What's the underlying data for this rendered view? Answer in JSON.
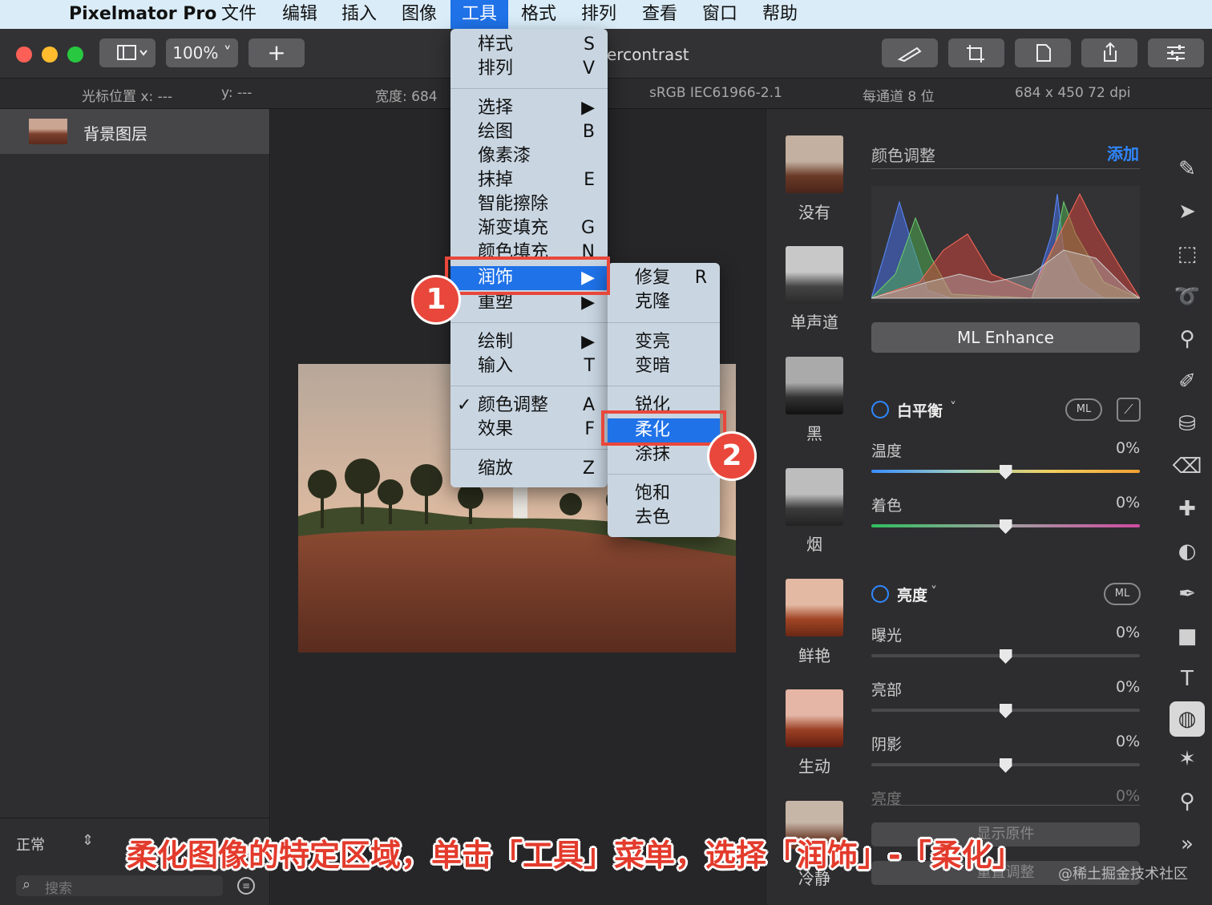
{
  "menubar": {
    "app_name": "Pixelmator Pro",
    "items": [
      "文件",
      "编辑",
      "插入",
      "图像",
      "工具",
      "格式",
      "排列",
      "查看",
      "窗口",
      "帮助"
    ],
    "active_item": "工具"
  },
  "toolbar": {
    "zoom": "100%",
    "add_label": "+",
    "document_title_partial": "ercontrast"
  },
  "infobar": {
    "cursor_label": "光标位置 x: ---",
    "cursor_y": "y: ---",
    "width": "宽度: 684",
    "color_profile": "sRGB IEC61966-2.1",
    "bit_depth": "每通道 8 位",
    "dimensions": "684 x 450 72 dpi"
  },
  "layers": {
    "items": [
      {
        "label": "背景图层"
      }
    ],
    "blend_mode": "正常",
    "search_placeholder": "搜索"
  },
  "tools_menu": {
    "rows": [
      {
        "label": "样式",
        "shortcut": "S"
      },
      {
        "label": "排列",
        "shortcut": "V"
      },
      {
        "label": "选择",
        "shortcut": "▶"
      },
      {
        "label": "绘图",
        "shortcut": "B"
      },
      {
        "label": "像素漆",
        "shortcut": ""
      },
      {
        "label": "抹掉",
        "shortcut": "E"
      },
      {
        "label": "智能擦除",
        "shortcut": ""
      },
      {
        "label": "渐变填充",
        "shortcut": "G"
      },
      {
        "label": "颜色填充",
        "shortcut": "N"
      },
      {
        "label": "润饰",
        "shortcut": "▶"
      },
      {
        "label": "重塑",
        "shortcut": "▶"
      },
      {
        "label": "绘制",
        "shortcut": "▶"
      },
      {
        "label": "输入",
        "shortcut": "T"
      },
      {
        "label": "颜色调整",
        "shortcut": "A",
        "checked": true
      },
      {
        "label": "效果",
        "shortcut": "F"
      },
      {
        "label": "缩放",
        "shortcut": "Z"
      }
    ],
    "check_mark": "✓"
  },
  "retouch_submenu": {
    "rows": [
      {
        "label": "修复",
        "shortcut": "R"
      },
      {
        "label": "克隆",
        "shortcut": ""
      },
      {
        "label": "变亮",
        "shortcut": ""
      },
      {
        "label": "变暗",
        "shortcut": ""
      },
      {
        "label": "锐化",
        "shortcut": ""
      },
      {
        "label": "柔化",
        "shortcut": ""
      },
      {
        "label": "涂抹",
        "shortcut": ""
      },
      {
        "label": "饱和",
        "shortcut": ""
      },
      {
        "label": "去色",
        "shortcut": ""
      }
    ]
  },
  "badges": [
    "1",
    "2"
  ],
  "presets": [
    "没有",
    "单声道",
    "黑",
    "烟",
    "鲜艳",
    "生动",
    "冷静"
  ],
  "adjust": {
    "header": "颜色调整",
    "add_label": "添加",
    "ml_enhance": "ML Enhance",
    "white_balance": {
      "title": "白平衡",
      "ml": "ML",
      "temperature_label": "温度",
      "temperature_value": "0%",
      "tint_label": "着色",
      "tint_value": "0%"
    },
    "lightness": {
      "title": "亮度",
      "ml": "ML",
      "exposure_label": "曝光",
      "exposure_value": "0%",
      "highlights_label": "亮部",
      "highlights_value": "0%",
      "shadows_label": "阴影",
      "shadows_value": "0%",
      "brightness_label": "亮度",
      "brightness_value": "0%"
    },
    "show_original": "显示原件",
    "reset": "重置调整"
  },
  "sliders": {
    "temperature_level": 0.5,
    "tint_level": 0.5,
    "exposure_level": 0.5,
    "highlights_level": 0.5,
    "shadows_level": 0.5
  },
  "colors": {
    "accent": "#1f72e8",
    "annotation_red": "#e9473b"
  },
  "caption": "柔化图像的特定区域，单击「工具」菜单，选择「润饰」-「柔化」",
  "watermark": "@稀土掘金技术社区"
}
